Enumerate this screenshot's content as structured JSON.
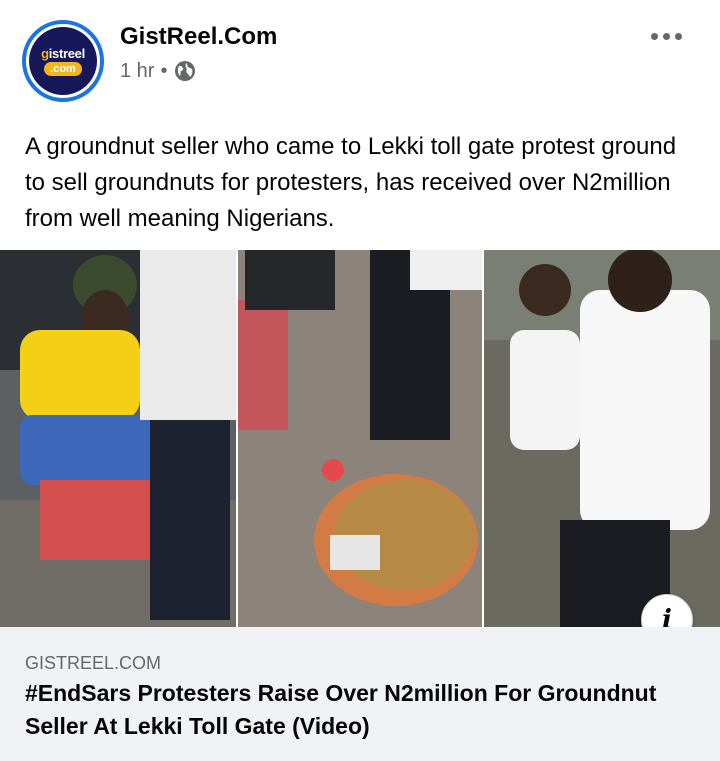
{
  "post": {
    "page_name": "GistReel.Com",
    "time": "1 hr",
    "separator": "•",
    "audience_icon": "globe-icon",
    "more_icon": "more-options-icon",
    "text": "A groundnut seller who came to Lekki toll gate protest ground to sell groundnuts for protesters, has received over N2million from well meaning Nigerians.",
    "avatar": {
      "logo_prefix": "g",
      "logo_word": "istreel",
      "logo_tag": ".com",
      "ring_color": "#1b74e4",
      "bg_color": "#16185a",
      "accent_color": "#f2b51c"
    }
  },
  "media": {
    "description_icon": "video-thumbnail-collage",
    "info_icon": "info-icon",
    "info_glyph": "i"
  },
  "link_preview": {
    "domain": "GISTREEL.COM",
    "title": "#EndSars Protesters Raise Over N2million For Groundnut Seller At Lekki Toll Gate (Video)"
  },
  "colors": {
    "text_primary": "#050505",
    "text_secondary": "#65676b",
    "preview_bg": "#f0f2f5"
  }
}
